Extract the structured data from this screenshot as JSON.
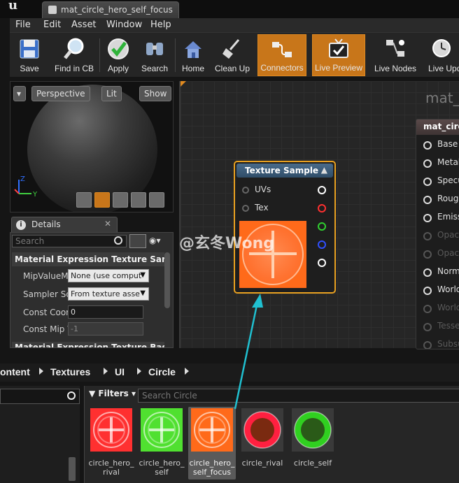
{
  "window": {
    "tab_title": "mat_circle_hero_self_focus"
  },
  "menu": [
    "File",
    "Edit",
    "Asset",
    "Window",
    "Help"
  ],
  "toolbar": [
    {
      "label": "Save",
      "icon": "floppy-icon",
      "active": false
    },
    {
      "label": "Find in CB",
      "icon": "magnifier-icon",
      "active": false
    },
    {
      "label": "Apply",
      "icon": "checkmark-icon",
      "active": false
    },
    {
      "label": "Search",
      "icon": "binoculars-icon",
      "active": false
    },
    {
      "label": "Home",
      "icon": "house-icon",
      "active": false
    },
    {
      "label": "Clean Up",
      "icon": "broom-icon",
      "active": false
    },
    {
      "label": "Connectors",
      "icon": "connectors-icon",
      "active": true
    },
    {
      "label": "Live Preview",
      "icon": "tv-icon",
      "active": true
    },
    {
      "label": "Live Nodes",
      "icon": "nodes-icon",
      "active": false
    },
    {
      "label": "Live Upd",
      "icon": "clock-icon",
      "active": false
    }
  ],
  "viewport": {
    "perspective": "Perspective",
    "lit": "Lit",
    "show": "Show",
    "axis_z": "Z",
    "axis_y": "Y"
  },
  "details": {
    "tab": "Details",
    "search_placeholder": "Search",
    "section": "Material Expression Texture Samp",
    "section2": "Material Expression Texture Base",
    "props": [
      {
        "label": "MipValueM",
        "value": "None (use comput"
      },
      {
        "label": "Sampler So",
        "value": "From texture asse"
      },
      {
        "label": "Const Coor",
        "value": "0"
      },
      {
        "label": "Const Mip V",
        "value": "-1"
      }
    ]
  },
  "graph": {
    "title": "mat_c",
    "texture_node": {
      "title": "Texture Sample",
      "inputs": [
        "UVs",
        "Tex"
      ],
      "output_colors": [
        "#ffffff",
        "#ff3030",
        "#30d030",
        "#3050ff",
        "#ffffff"
      ]
    },
    "result_node": {
      "title": "mat_circ",
      "pins": [
        {
          "label": "Base C",
          "dim": false
        },
        {
          "label": "Metall",
          "dim": false
        },
        {
          "label": "Specu",
          "dim": false
        },
        {
          "label": "Rough",
          "dim": false
        },
        {
          "label": "Emiss",
          "dim": false
        },
        {
          "label": "Opaci",
          "dim": true
        },
        {
          "label": "Opaci",
          "dim": true
        },
        {
          "label": "Norma",
          "dim": false
        },
        {
          "label": "World",
          "dim": false
        },
        {
          "label": "World",
          "dim": true
        },
        {
          "label": "Tesse",
          "dim": true
        },
        {
          "label": "Subsu",
          "dim": true
        }
      ]
    },
    "watermark": "@玄冬Wong"
  },
  "breadcrumb": [
    "ontent",
    "Textures",
    "UI",
    "Circle"
  ],
  "content_browser": {
    "filters_label": "Filters",
    "search_placeholder": "Search Circle",
    "assets": [
      {
        "name": "circle_hero_ rival",
        "bg": "#ff3030",
        "kind": "cross",
        "selected": false
      },
      {
        "name": "circle_hero_ self",
        "bg": "#50e030",
        "kind": "cross",
        "selected": false
      },
      {
        "name": "circle_hero_ self_focus",
        "bg": "#ff6a1a",
        "kind": "cross",
        "selected": true
      },
      {
        "name": "circle_rival",
        "bg": "#ff2040",
        "kind": "ring",
        "selected": false
      },
      {
        "name": "circle_self",
        "bg": "#30d020",
        "kind": "ring",
        "selected": false
      }
    ]
  },
  "colors": {
    "accent_orange": "#c8761a",
    "callout": "#20c0d0"
  }
}
